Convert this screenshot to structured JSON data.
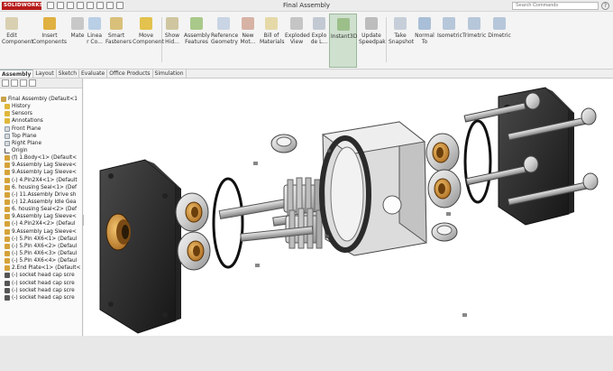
{
  "app": {
    "logo_text": "SOLIDWORKS",
    "document_title": "Final Assembly"
  },
  "search": {
    "placeholder": "Search Commands"
  },
  "ribbon": {
    "buttons": [
      {
        "label": "Edit\nComponent",
        "icon": "edit-component-icon"
      },
      {
        "label": "Insert\nComponents",
        "icon": "insert-components-icon"
      },
      {
        "label": "Mate",
        "icon": "mate-icon"
      },
      {
        "label": "Linea\nr Co...",
        "icon": "linear-pattern-icon"
      },
      {
        "label": "Smart\nFasteners",
        "icon": "smart-fasteners-icon"
      },
      {
        "label": "Move\nComponent",
        "icon": "move-component-icon"
      },
      {
        "label": "Show\nHid...",
        "icon": "show-hidden-icon"
      },
      {
        "label": "Assembly\nFeatures",
        "icon": "assembly-features-icon"
      },
      {
        "label": "Reference\nGeometry",
        "icon": "reference-geometry-icon"
      },
      {
        "label": "New\nMot...",
        "icon": "new-motion-study-icon"
      },
      {
        "label": "Bill of\nMaterials",
        "icon": "bill-of-materials-icon"
      },
      {
        "label": "Exploded\nView",
        "icon": "exploded-view-icon"
      },
      {
        "label": "Explo\nde L...",
        "icon": "explode-line-icon"
      },
      {
        "label": "Instant3D",
        "icon": "instant3d-icon"
      },
      {
        "label": "Update\nSpeedpak",
        "icon": "update-speedpak-icon"
      },
      {
        "label": "Take\nSnapshot",
        "icon": "take-snapshot-icon"
      },
      {
        "label": "Normal\nTo",
        "icon": "normal-to-icon"
      },
      {
        "label": "Isometric",
        "icon": "isometric-icon"
      },
      {
        "label": "Trimetric",
        "icon": "trimetric-icon"
      },
      {
        "label": "Dimetric",
        "icon": "dimetric-icon"
      }
    ]
  },
  "command_tabs": [
    "Assembly",
    "Layout",
    "Sketch",
    "Evaluate",
    "Office Products",
    "Simulation"
  ],
  "tree": {
    "items": [
      "Final Assembly  (Default<1",
      "History",
      "Sensors",
      "Annotations",
      "Front Plane",
      "Top Plane",
      "Right Plane",
      "Origin",
      "(f) 1.Body<1> (Default<",
      "9.Assembly Lag Sleeve<",
      "9.Assembly Lag Sleeve<",
      "(-) 4.Pin2X4<1> (Default",
      "6. housing Seal<1> (Def",
      "(-) 11.Assembly Drive sh",
      "(-) 12.Assembly Idle Gea",
      "6. housing Seal<2> (Def",
      "9.Assembly Lag Sleeve<",
      "(-) 4.Pin2X4<2> (Defaul",
      "9.Assembly Lag Sleeve<",
      "(-) 5.Pin 4X6<1> (Defaul",
      "(-) 5.Pin 4X6<2> (Defaul",
      "(-) 5.Pin 4X6<3> (Defaul",
      "(-) 5.Pin 4X6<4> (Defaul",
      "2.End Plate<1> (Default<",
      "(-) socket head cap scre",
      "(-) socket head cap scre",
      "(-) socket head cap scre",
      "(-) socket head cap scre"
    ]
  },
  "colors": {
    "accent_red": "#b71b1b",
    "bronze": "#c9832e",
    "part_dark": "#2a2a2a"
  }
}
